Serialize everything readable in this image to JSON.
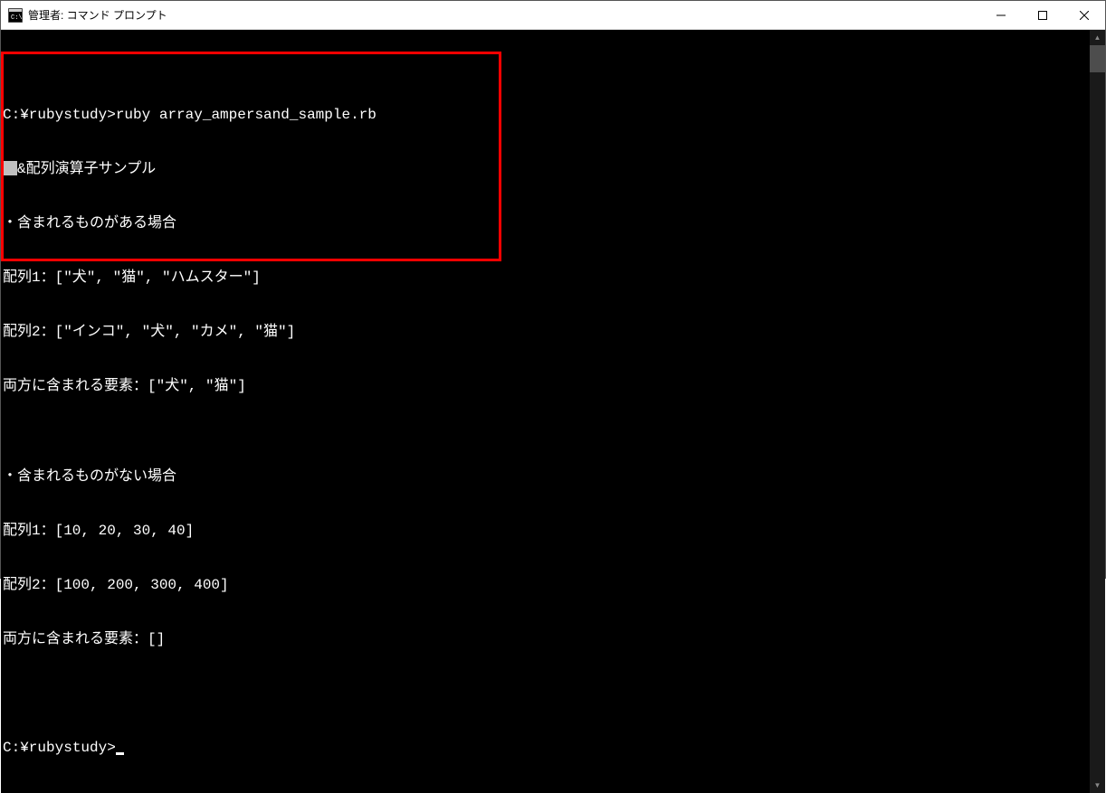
{
  "titlebar": {
    "title": "管理者: コマンド プロンプト"
  },
  "terminal": {
    "prompt1": "C:¥rubystudy>",
    "command": "ruby array_ampersand_sample.rb",
    "output_line1_suffix": "&配列演算子サンプル",
    "output_line2": "・含まれるものがある場合",
    "output_line3": "配列1：[\"犬\", \"猫\", \"ハムスター\"]",
    "output_line4": "配列2：[\"インコ\", \"犬\", \"カメ\", \"猫\"]",
    "output_line5": "両方に含まれる要素：[\"犬\", \"猫\"]",
    "output_line6": "",
    "output_line7": "・含まれるものがない場合",
    "output_line8": "配列1：[10, 20, 30, 40]",
    "output_line9": "配列2：[100, 200, 300, 400]",
    "output_line10": "両方に含まれる要素：[]",
    "prompt2": "C:¥rubystudy>"
  },
  "highlight": {
    "color": "#ff0000"
  }
}
